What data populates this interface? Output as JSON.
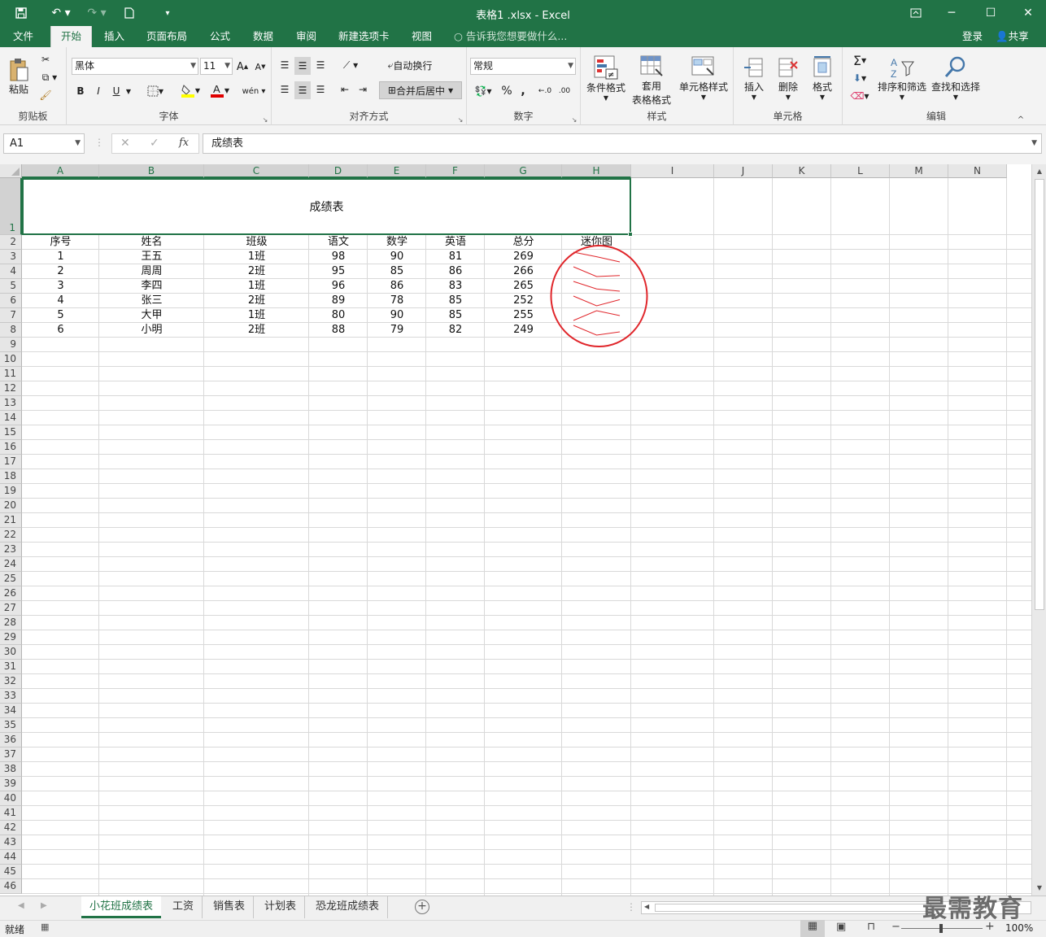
{
  "window": {
    "title": "表格1 .xlsx - Excel",
    "login_label": "登录",
    "share_label": "共享"
  },
  "ribbon_tabs": [
    "文件",
    "开始",
    "插入",
    "页面布局",
    "公式",
    "数据",
    "审阅",
    "新建选项卡",
    "视图"
  ],
  "tell_me": "告诉我您想要做什么...",
  "ribbon": {
    "clipboard": {
      "paste": "粘贴",
      "label": "剪贴板"
    },
    "font": {
      "name": "黑体",
      "size": "11",
      "label": "字体",
      "bold": "B",
      "italic": "I",
      "underline": "U"
    },
    "alignment": {
      "wrap": "自动换行",
      "merge": "合并后居中",
      "label": "对齐方式"
    },
    "number": {
      "format": "常规",
      "label": "数字",
      "percent": "%",
      "comma": ","
    },
    "styles": {
      "conditional": "条件格式",
      "table_line1": "套用",
      "table_line2": "表格格式",
      "cell_styles": "单元格样式",
      "label": "样式"
    },
    "cells": {
      "insert": "插入",
      "delete": "删除",
      "format": "格式",
      "label": "单元格"
    },
    "editing": {
      "sort": "排序和筛选",
      "find": "查找和选择",
      "label": "编辑"
    }
  },
  "formula_bar": {
    "name_box": "A1",
    "fx": "fx",
    "content": "成绩表"
  },
  "columns": [
    "A",
    "B",
    "C",
    "D",
    "E",
    "F",
    "G",
    "H",
    "I",
    "J",
    "K",
    "L",
    "M",
    "N"
  ],
  "rows": [
    "1",
    "2",
    "3",
    "4",
    "5",
    "6",
    "7",
    "8",
    "9",
    "10",
    "11",
    "12",
    "13",
    "14",
    "15",
    "16",
    "17",
    "18",
    "19",
    "20",
    "21",
    "22",
    "23",
    "24",
    "25",
    "26",
    "27",
    "28",
    "29",
    "30",
    "31",
    "32",
    "33",
    "34",
    "35",
    "36",
    "37",
    "38",
    "39",
    "40",
    "41",
    "42",
    "43",
    "44",
    "45",
    "46"
  ],
  "sheet": {
    "title": "成绩表",
    "headers": [
      "序号",
      "姓名",
      "班级",
      "语文",
      "数学",
      "英语",
      "总分",
      "迷你图"
    ],
    "data": [
      [
        "1",
        "王五",
        "1班",
        "98",
        "90",
        "81",
        "269"
      ],
      [
        "2",
        "周周",
        "2班",
        "95",
        "85",
        "86",
        "266"
      ],
      [
        "3",
        "李四",
        "1班",
        "96",
        "86",
        "83",
        "265"
      ],
      [
        "4",
        "张三",
        "2班",
        "89",
        "78",
        "85",
        "252"
      ],
      [
        "5",
        "大甲",
        "1班",
        "80",
        "90",
        "85",
        "255"
      ],
      [
        "6",
        "小明",
        "2班",
        "88",
        "79",
        "82",
        "249"
      ]
    ]
  },
  "sheet_tabs": [
    "小花班成绩表",
    "工资",
    "销售表",
    "计划表",
    "恐龙班成绩表"
  ],
  "status": {
    "ready": "就绪",
    "zoom": "100%"
  },
  "watermark": "最需教育",
  "colors": {
    "accent": "#217346",
    "annotation": "#e0262b",
    "sparkline": "#e0262b"
  }
}
